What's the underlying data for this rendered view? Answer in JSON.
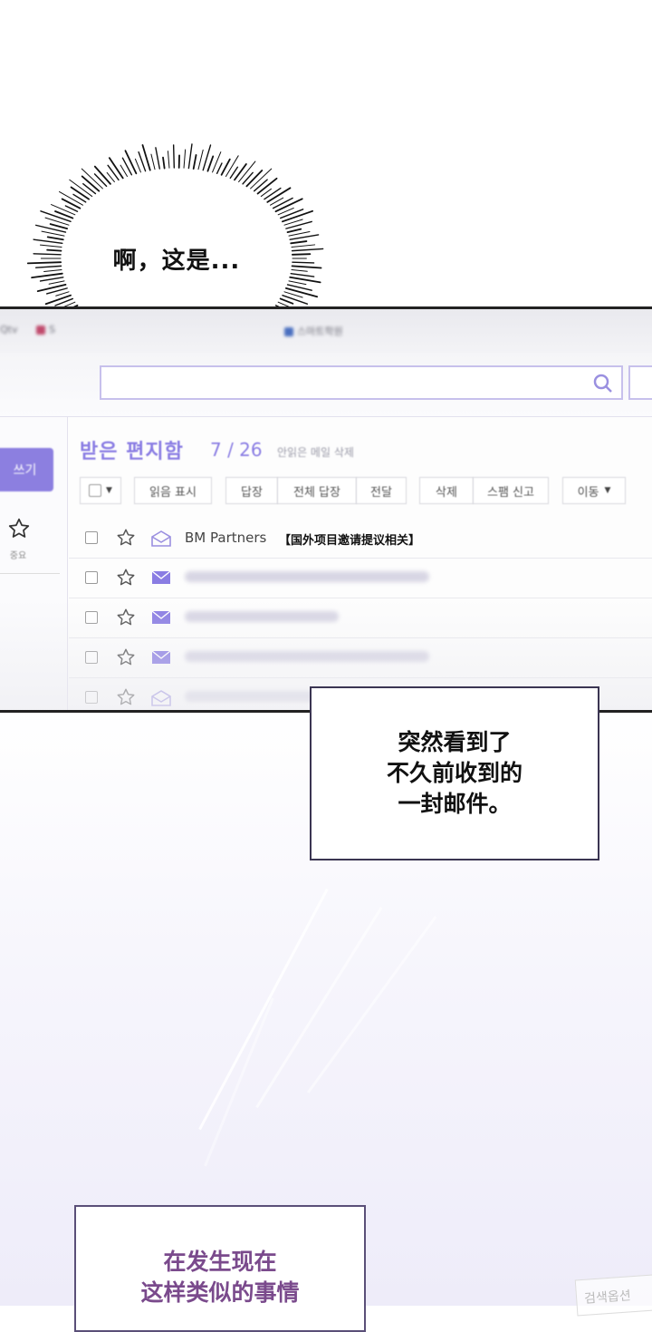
{
  "burst": {
    "text": "啊，这是..."
  },
  "browser": {
    "bookmarks": [
      "Qtv",
      "S",
      "스마트학원"
    ],
    "search_placeholder": ""
  },
  "sidebar": {
    "write_label": "쓰기",
    "star_label": "중요"
  },
  "inbox": {
    "title": "받은 편지함",
    "count": "7 / 26",
    "unread_delete": "안읽은 메일 삭제",
    "toolbar": {
      "mark_read": "읽음 표시",
      "reply": "답장",
      "reply_all": "전체 답장",
      "forward": "전달",
      "delete": "삭제",
      "spam": "스팸 신고",
      "move": "이동"
    },
    "rows": [
      {
        "sender": "BM Partners",
        "subject": "【国外项目邀请提议相关】",
        "read": true
      },
      {
        "sender": "",
        "subject": "",
        "read": false
      },
      {
        "sender": "",
        "subject": "",
        "read": false
      },
      {
        "sender": "",
        "subject": "",
        "read": false
      },
      {
        "sender": "",
        "subject": "",
        "read": true
      }
    ]
  },
  "caption1": {
    "line1": "突然看到了",
    "line2": "不久前收到的",
    "line3": "一封邮件。"
  },
  "caption2": {
    "line1": "在发生现在",
    "line2": "这样类似的事情"
  },
  "bottom_card": {
    "text": "검색옵션"
  },
  "colors": {
    "accent": "#8a7de3",
    "caption_border": "#3b3552",
    "caption2_text": "#7a4a8c"
  }
}
